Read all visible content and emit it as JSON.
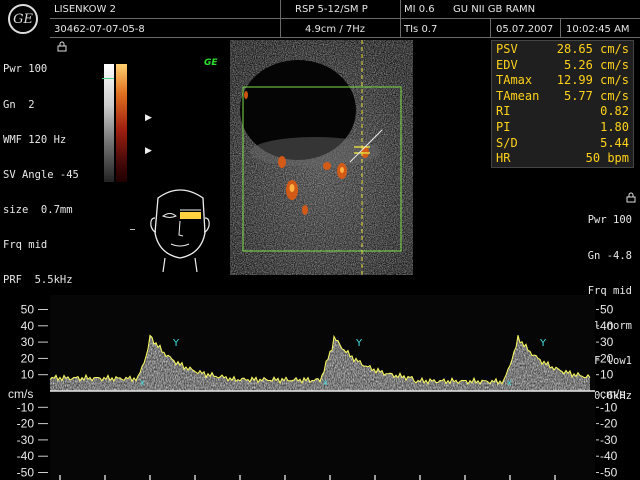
{
  "header": {
    "logo": "GE",
    "patient": "LISENKOW 2",
    "patient_id": "30462-07-07-05-8",
    "probe": "RSP 5-12/SM P",
    "depth_freq": "4.9cm / 7Hz",
    "mi": "MI 0.6",
    "tis": "TIs 0.7",
    "institution": "GU NII GB RAMN",
    "date": "05.07.2007",
    "time": "10:02:45 AM"
  },
  "left_params": [
    "Pwr 100",
    "Gn  2",
    "WMF 120 Hz",
    "SV Angle -45",
    "size  0.7mm",
    "Frq mid",
    "PRF  5.5kHz"
  ],
  "right_params": [
    "Pwr 100",
    "Gn -4.8",
    "Frq mid",
    "Qual norm",
    "WMF low1",
    "PRF  0.6kHz"
  ],
  "ge_mark": "GE",
  "measurements": [
    {
      "label": "PSV",
      "value": "28.65 cm/s"
    },
    {
      "label": "EDV",
      "value": "5.26 cm/s"
    },
    {
      "label": "TAmax",
      "value": "12.99 cm/s"
    },
    {
      "label": "TAmean",
      "value": "5.77 cm/s"
    },
    {
      "label": "RI",
      "value": "0.82"
    },
    {
      "label": "PI",
      "value": "1.80"
    },
    {
      "label": "S/D",
      "value": "5.44"
    },
    {
      "label": "HR",
      "value": "50 bpm"
    }
  ],
  "spectrum": {
    "unit": "cm/s",
    "ticks": [
      "50",
      "40",
      "30",
      "20",
      "10",
      "-10",
      "-20",
      "-30",
      "-40",
      "-50"
    ]
  },
  "colors": {
    "measure_text": "#ffd21a",
    "roi_box": "#7adf4a",
    "cursor": "#e8e040",
    "trace": "#ffff60"
  }
}
